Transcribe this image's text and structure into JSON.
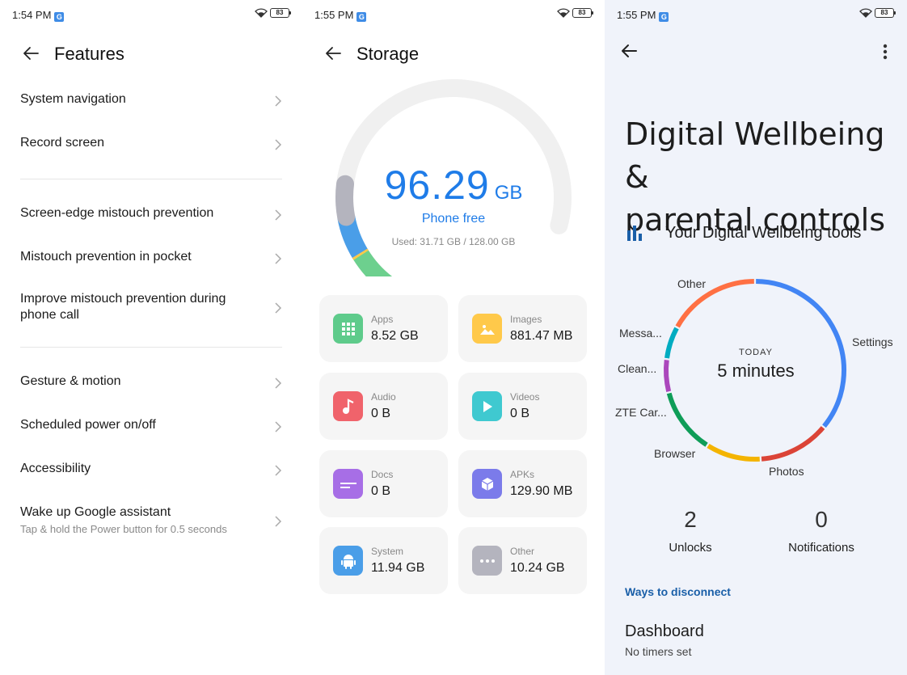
{
  "screen1": {
    "status": {
      "time": "1:54 PM",
      "g": "G",
      "battery": "83"
    },
    "title": "Features",
    "items": [
      {
        "label": "System navigation"
      },
      {
        "label": "Record screen"
      },
      {
        "label": "Screen-edge mistouch prevention"
      },
      {
        "label": "Mistouch prevention in pocket"
      },
      {
        "label": "Improve mistouch prevention during phone call"
      },
      {
        "label": "Gesture & motion"
      },
      {
        "label": "Scheduled power on/off"
      },
      {
        "label": "Accessibility"
      },
      {
        "label": "Wake up Google assistant",
        "sub": "Tap & hold the Power button for 0.5 seconds"
      }
    ]
  },
  "screen2": {
    "status": {
      "time": "1:55 PM",
      "g": "G",
      "battery": "83"
    },
    "title": "Storage",
    "free_value": "96.29",
    "free_unit": "GB",
    "free_label": "Phone free",
    "used_text": "Used: 31.71 GB / 128.00 GB",
    "used_fraction": 0.2477,
    "accent": "#1f7ce8",
    "cards": [
      {
        "label": "Apps",
        "value": "8.52 GB",
        "color": "#5ecb8b",
        "icon": "apps-grid-icon"
      },
      {
        "label": "Images",
        "value": "881.47 MB",
        "color": "#ffc94a",
        "icon": "image-icon"
      },
      {
        "label": "Audio",
        "value": "0 B",
        "color": "#f0636b",
        "icon": "music-note-icon"
      },
      {
        "label": "Videos",
        "value": "0 B",
        "color": "#3fc9d0",
        "icon": "play-icon"
      },
      {
        "label": "Docs",
        "value": "0 B",
        "color": "#a76ee6",
        "icon": "document-icon"
      },
      {
        "label": "APKs",
        "value": "129.90 MB",
        "color": "#7b7bea",
        "icon": "package-icon"
      },
      {
        "label": "System",
        "value": "11.94 GB",
        "color": "#4a9ee8",
        "icon": "android-icon"
      },
      {
        "label": "Other",
        "value": "10.24 GB",
        "color": "#b4b4be",
        "icon": "more-dots-icon"
      }
    ]
  },
  "screen3": {
    "status": {
      "time": "1:55 PM",
      "g": "G",
      "battery": "83"
    },
    "title_line1": "Digital Wellbeing &",
    "title_line2": "parental controls",
    "tools_label": "Your Digital Wellbeing tools",
    "today_label": "TODAY",
    "total_time": "5 minutes",
    "segments": [
      {
        "label": "Settings",
        "color": "#4285f4",
        "fraction": 0.36
      },
      {
        "label": "Photos",
        "color": "#db4437",
        "fraction": 0.13
      },
      {
        "label": "Browser",
        "color": "#f4b400",
        "fraction": 0.1
      },
      {
        "label": "ZTE Car...",
        "color": "#0f9d58",
        "fraction": 0.12
      },
      {
        "label": "Clean...",
        "color": "#ab47bc",
        "fraction": 0.06
      },
      {
        "label": "Messa...",
        "color": "#00acc1",
        "fraction": 0.06
      },
      {
        "label": "Other",
        "color": "#ff7043",
        "fraction": 0.17
      }
    ],
    "unlocks_count": "2",
    "unlocks_label": "Unlocks",
    "notifications_count": "0",
    "notifications_label": "Notifications",
    "ways_link": "Ways to disconnect",
    "dashboard_title": "Dashboard",
    "dashboard_sub": "No timers set"
  }
}
